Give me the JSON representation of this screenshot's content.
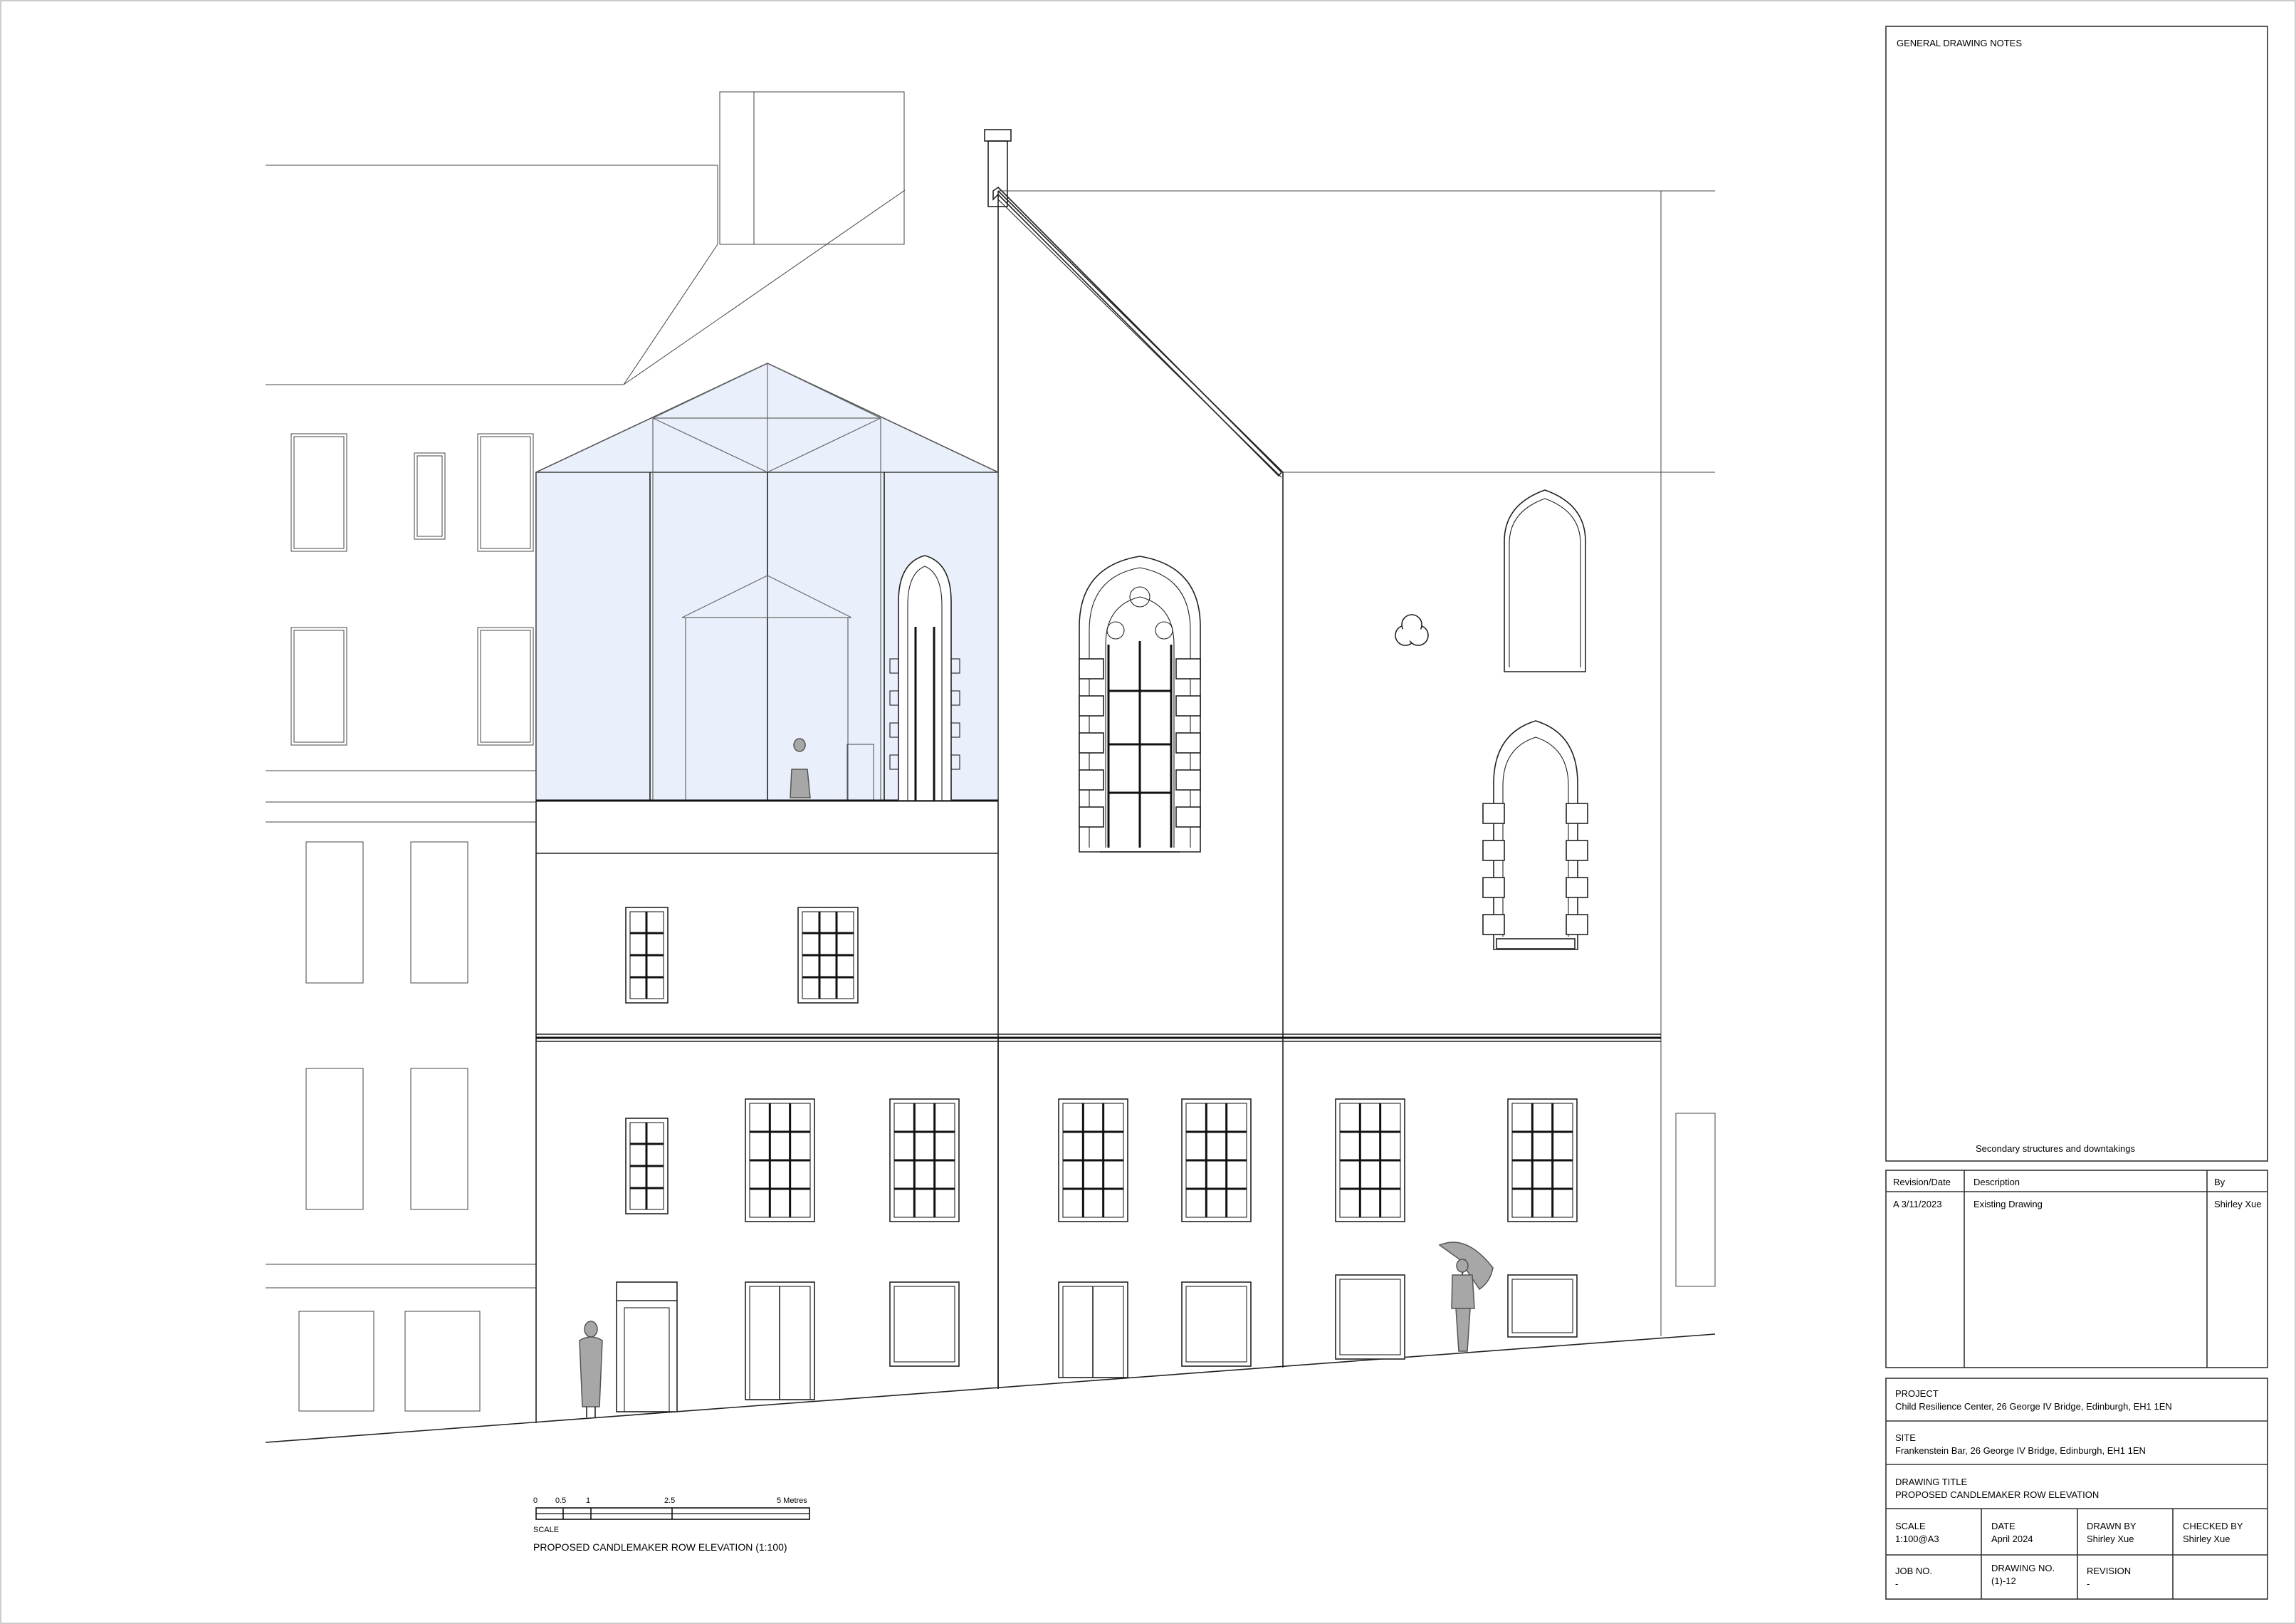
{
  "notes": {
    "heading": "GENERAL DRAWING NOTES",
    "caption": "Secondary structures and downtakings"
  },
  "revisions": {
    "headers": [
      "Revision/Date",
      "Description",
      "By"
    ],
    "rows": [
      {
        "rev": "A 3/11/2023",
        "desc": "Existing Drawing",
        "by": "Shirley Xue"
      }
    ]
  },
  "title_block": {
    "project_label": "PROJECT",
    "project_value": "Child Resilience Center, 26 George IV Bridge, Edinburgh, EH1 1EN",
    "site_label": "SITE",
    "site_value": "Frankenstein Bar, 26 George IV Bridge, Edinburgh, EH1 1EN",
    "drawing_title_label": "DRAWING TITLE",
    "drawing_title_value": "PROPOSED CANDLEMAKER ROW ELEVATION",
    "scale_label": "SCALE",
    "scale_value": "1:100@A3",
    "date_label": "DATE",
    "date_value": "April 2024",
    "drawn_by_label": "DRAWN BY",
    "drawn_by_value": "Shirley Xue",
    "checked_by_label": "CHECKED BY",
    "checked_by_value": "Shirley Xue",
    "job_no_label": "JOB NO.",
    "job_no_value": "-",
    "drawing_no_label": "DRAWING NO.",
    "drawing_no_value": "(1)-12",
    "revision_label": "REVISION",
    "revision_value": "-"
  },
  "scale_bar": {
    "ticks": [
      "0",
      "0.5",
      "1",
      "2.5",
      "5 Metres"
    ],
    "label": "SCALE",
    "caption": "PROPOSED CANDLEMAKER ROW ELEVATION (1:100)"
  },
  "colors": {
    "glazing": "#eaf0fb",
    "figures": "#a7a7a7",
    "linework": "#222222"
  }
}
